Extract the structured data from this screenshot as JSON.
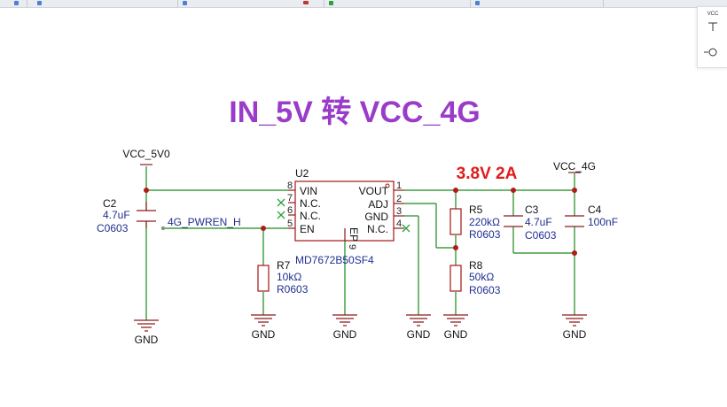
{
  "title": "IN_5V 转 VCC_4G",
  "annotation": "3.8V 2A",
  "toolbar_panel": {
    "vcc_label": "VCC"
  },
  "power": {
    "vcc_5v0": "VCC_5V0",
    "vcc_4g": "VCC_4G"
  },
  "ground_label": "GND",
  "net_label": "4G_PWREN_H",
  "u2": {
    "ref": "U2",
    "part": "MD7672B50SF4",
    "left_pins": [
      {
        "name": "VIN",
        "num": "8"
      },
      {
        "name": "N.C.",
        "num": "7"
      },
      {
        "name": "N.C.",
        "num": "6"
      },
      {
        "name": "EN",
        "num": "5"
      }
    ],
    "right_pins": [
      {
        "name": "VOUT",
        "num": "1"
      },
      {
        "name": "ADJ",
        "num": "2"
      },
      {
        "name": "GND",
        "num": "3"
      },
      {
        "name": "N.C.",
        "num": "4"
      }
    ],
    "ep_name": "EP",
    "ep_num": "9"
  },
  "c2": {
    "ref": "C2",
    "value": "4.7uF",
    "package": "C0603"
  },
  "r7": {
    "ref": "R7",
    "value": "10kΩ",
    "package": "R0603"
  },
  "r5": {
    "ref": "R5",
    "value": "220kΩ",
    "package": "R0603"
  },
  "r8": {
    "ref": "R8",
    "value": "50kΩ",
    "package": "R0603"
  },
  "c3": {
    "ref": "C3",
    "value": "4.7uF",
    "package": "C0603"
  },
  "c4": {
    "ref": "C4",
    "value": "100nF"
  },
  "colors": {
    "wire": "#1a8a1a",
    "symbol": "#a31515",
    "title": "#9a3cc9",
    "annotation": "#e01b1b",
    "label": "#1f2f8f"
  }
}
